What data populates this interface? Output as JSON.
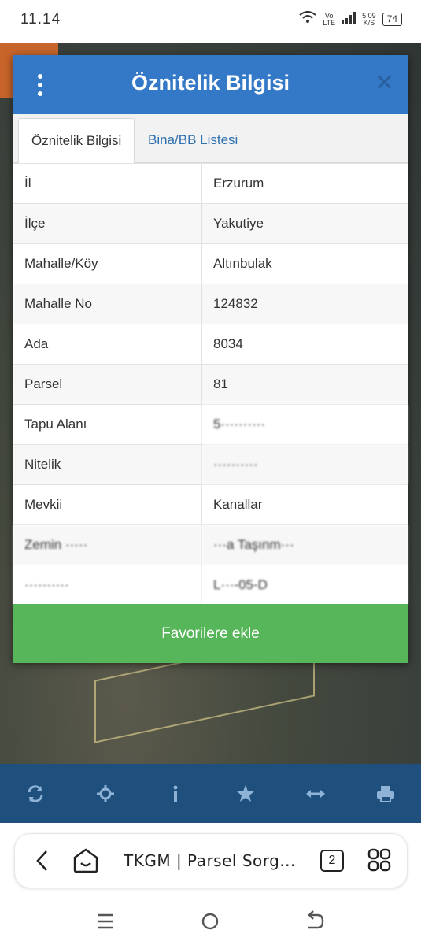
{
  "status_bar": {
    "time": "11.14",
    "network_top": "Vo",
    "network_bottom": "LTE",
    "speed_value": "5,09",
    "speed_unit": "K/S",
    "battery": "74"
  },
  "dialog": {
    "title": "Öznitelik Bilgisi",
    "tabs": [
      {
        "label": "Öznitelik Bilgisi",
        "active": true
      },
      {
        "label": "Bina/BB Listesi",
        "active": false
      }
    ],
    "rows": [
      {
        "key": "İl",
        "value": "Erzurum"
      },
      {
        "key": "İlçe",
        "value": "Yakutiye"
      },
      {
        "key": "Mahalle/Köy",
        "value": "Altınbulak"
      },
      {
        "key": "Mahalle No",
        "value": "124832"
      },
      {
        "key": "Ada",
        "value": "8034"
      },
      {
        "key": "Parsel",
        "value": "81"
      },
      {
        "key": "Tapu Alanı",
        "value": "5··········"
      },
      {
        "key": "Nitelik",
        "value": "··········"
      },
      {
        "key": "Mevkii",
        "value": "Kanallar"
      },
      {
        "key": "Zemin ·····",
        "value": "···a Taşınm···"
      },
      {
        "key": "··········",
        "value": "L···-05-D"
      }
    ],
    "favorite_label": "Favorilere ekle"
  },
  "colors": {
    "header_blue": "#3479c7",
    "favorite_green": "#57b65a",
    "toolbar_navy": "#1e4f7d"
  },
  "toolbar": {
    "icons": [
      "refresh-icon",
      "locate-icon",
      "info-icon",
      "star-icon",
      "measure-icon",
      "print-icon"
    ]
  },
  "browser": {
    "page_title": "TKGM | Parsel Sorg...",
    "tab_count": "2"
  }
}
